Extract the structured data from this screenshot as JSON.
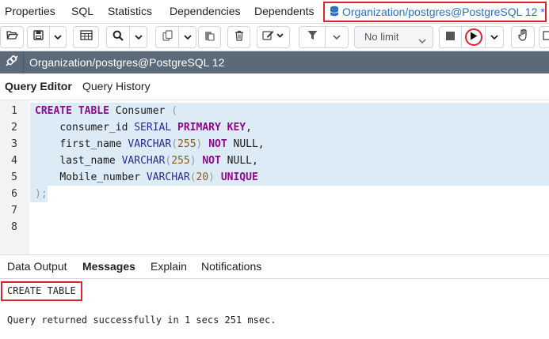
{
  "top_tabs": {
    "properties": "Properties",
    "sql": "SQL",
    "statistics": "Statistics",
    "dependencies": "Dependencies",
    "dependents": "Dependents",
    "query_tab": "Organization/postgres@PostgreSQL 12 *"
  },
  "toolbar": {
    "limit_select": "No limit"
  },
  "connection": {
    "label": "Organization/postgres@PostgreSQL 12"
  },
  "editor_tabs": {
    "query_editor": "Query Editor",
    "query_history": "Query History"
  },
  "editor": {
    "line_numbers": [
      "1",
      "2",
      "3",
      "4",
      "5",
      "6",
      "7",
      "8"
    ],
    "line1": {
      "kw1": "CREATE",
      "kw2": "TABLE",
      "name": "Consumer",
      "paren": "("
    },
    "line2": {
      "col": "consumer_id",
      "type": "SERIAL",
      "kw": "PRIMARY KEY",
      "end": ","
    },
    "line3": {
      "col": "first_name",
      "type": "VARCHAR",
      "open": "(",
      "len": "255",
      "close": ")",
      "kw": "NOT",
      "rest": "NULL,"
    },
    "line4": {
      "col": "last_name",
      "type": "VARCHAR",
      "open": "(",
      "len": "255",
      "close": ")",
      "kw": "NOT",
      "rest": "NULL,"
    },
    "line5": {
      "col": "Mobile_number",
      "type": "VARCHAR",
      "open": "(",
      "len": "20",
      "close": ")",
      "kw": "UNIQUE"
    },
    "line6": {
      "text": ");"
    }
  },
  "results_tabs": {
    "data_output": "Data Output",
    "messages": "Messages",
    "explain": "Explain",
    "notifications": "Notifications"
  },
  "messages": {
    "status": "CREATE TABLE",
    "detail": "Query returned successfully in 1 secs 251 msec."
  },
  "colors": {
    "highlight_border": "#d9232d",
    "active_tab_text": "#2c6fbf",
    "connection_bar": "#5b6a78",
    "selection": "#dcebf6",
    "keyword": "#8b0a8b"
  },
  "icons": [
    "database-icon",
    "open-file-icon",
    "save-icon",
    "chevron-down-icon",
    "grid-icon",
    "search-icon",
    "copy-icon",
    "paste-icon",
    "delete-icon",
    "edit-icon",
    "filter-icon",
    "stop-icon",
    "execute-icon",
    "hand-icon",
    "connection-icon"
  ]
}
